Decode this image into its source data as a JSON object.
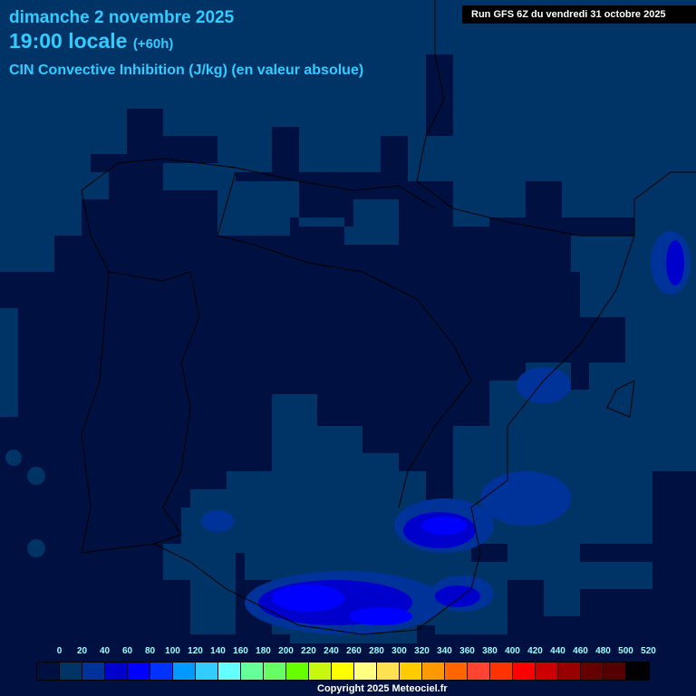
{
  "header": {
    "date": "dimanche 2 novembre 2025",
    "time": "19:00 locale",
    "lead": "(+60h)",
    "parameter": "CIN Convective Inhibition (J/kg) (en valeur absolue)",
    "run": "Run GFS 6Z du vendredi 31 octobre 2025"
  },
  "legend": {
    "labels": [
      "0",
      "20",
      "40",
      "60",
      "80",
      "100",
      "120",
      "140",
      "160",
      "180",
      "200",
      "220",
      "240",
      "260",
      "280",
      "300",
      "320",
      "340",
      "360",
      "380",
      "400",
      "420",
      "440",
      "460",
      "480",
      "500",
      "520"
    ],
    "colors": [
      "#001040",
      "#003366",
      "#003399",
      "#0000cc",
      "#0000ff",
      "#0033ff",
      "#0099ff",
      "#33ccff",
      "#66ffff",
      "#66ff99",
      "#66ff66",
      "#66ff00",
      "#c8f810",
      "#ffff00",
      "#ffff80",
      "#ffe050",
      "#ffcc00",
      "#ff9900",
      "#ff6600",
      "#ff4433",
      "#ff3300",
      "#ff0000",
      "#cc0000",
      "#990000",
      "#660000",
      "#550000",
      "#000000"
    ]
  },
  "copyright": "Copyright 2025 Meteociel.fr"
}
